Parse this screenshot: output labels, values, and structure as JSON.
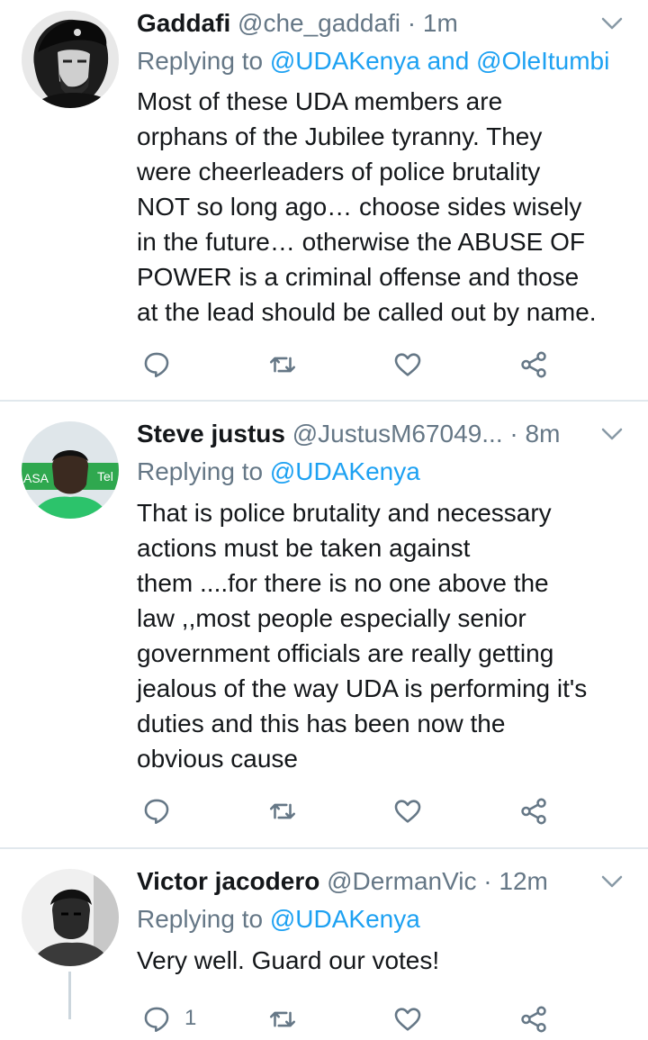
{
  "tweets": [
    {
      "name": "Gaddafi",
      "handle": "@che_gaddafi",
      "time": " · 1m",
      "reply_prefix": "Replying to ",
      "reply_to": "@UDAKenya and @OleItumbi",
      "lines": [
        "Most of these UDA members are",
        "orphans of the Jubilee tyranny. They",
        "were cheerleaders of police brutality",
        "NOT so long ago… choose sides wisely",
        "in the future… otherwise the ABUSE OF",
        "POWER is a criminal offense and those",
        "at the lead should be called out by name."
      ],
      "reply_count": "",
      "icons": [
        "reply-icon",
        "retweet-icon",
        "like-icon",
        "share-icon"
      ]
    },
    {
      "name": "Steve justus",
      "handle": "@JustusM67049...",
      "time": " · 8m",
      "reply_prefix": "Replying to ",
      "reply_to": "@UDAKenya",
      "lines": [
        "That is police brutality and necessary",
        "actions must be taken against",
        "them ....for there is no one above the",
        "law ,,most people especially senior",
        "government officials are really getting",
        "jealous of the way UDA is performing it's",
        "duties and this has been now the",
        "obvious cause"
      ],
      "reply_count": "",
      "icons": [
        "reply-icon",
        "retweet-icon",
        "like-icon",
        "share-icon"
      ]
    },
    {
      "name": "Victor jacodero",
      "handle": "@DermanVic",
      "time": " · 12m",
      "reply_prefix": "Replying to ",
      "reply_to": "@UDAKenya",
      "lines": [
        "Very well. Guard our votes!"
      ],
      "reply_count": "1",
      "icons": [
        "reply-icon",
        "retweet-icon",
        "like-icon",
        "share-icon"
      ]
    }
  ],
  "colors": {
    "text": "#14171a",
    "secondary": "#657786",
    "link": "#1da1f2",
    "divider": "#e1e8ed"
  }
}
